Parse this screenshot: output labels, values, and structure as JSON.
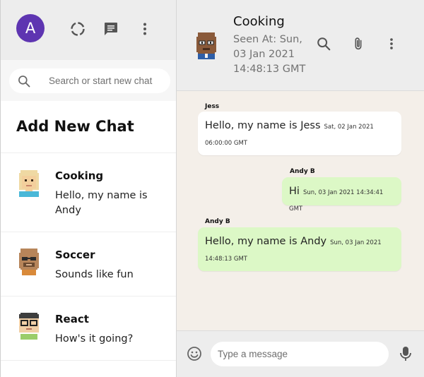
{
  "sidebar": {
    "avatar_letter": "A",
    "avatar_color": "#5e35b1",
    "header_icons": [
      "status-icon",
      "chat-icon",
      "more-vert-icon"
    ],
    "search": {
      "placeholder": "Search or start new chat",
      "icon": "search-icon"
    },
    "add_new_chat_label": "Add New Chat",
    "rooms": [
      {
        "name": "Cooking",
        "last_message": "Hello, my name is Andy",
        "avatar": "blonde-avatar"
      },
      {
        "name": "Soccer",
        "last_message": "Sounds like fun",
        "avatar": "bald-sunglasses-avatar"
      },
      {
        "name": "React",
        "last_message": "How's it going?",
        "avatar": "glasses-avatar"
      }
    ]
  },
  "chat": {
    "room_name": "Cooking",
    "seen_at": "Seen At: Sun, 03 Jan 2021 14:48:13 GMT",
    "header_icons": [
      "search-icon",
      "attach-icon",
      "more-vert-icon"
    ],
    "messages": [
      {
        "sender": "Jess",
        "text": "Hello, my name is Jess",
        "timestamp": "Sat, 02 Jan 2021 06:00:00 GMT",
        "outgoing": false
      },
      {
        "sender": "Andy B",
        "text": "Hi",
        "timestamp": "Sun, 03 Jan 2021 14:34:41 GMT",
        "outgoing": true
      },
      {
        "sender": "Andy B",
        "text": "Hello, my name is Andy",
        "timestamp": "Sun, 03 Jan 2021 14:48:13 GMT",
        "outgoing": true
      }
    ],
    "composer": {
      "placeholder": "Type a message",
      "emoji_icon": "emoji-icon",
      "mic_icon": "mic-icon"
    }
  },
  "colors": {
    "outgoing_bubble": "#dcf8c6",
    "incoming_bubble": "#ffffff",
    "chat_background": "#f4efe9",
    "header_background": "#ededed"
  }
}
